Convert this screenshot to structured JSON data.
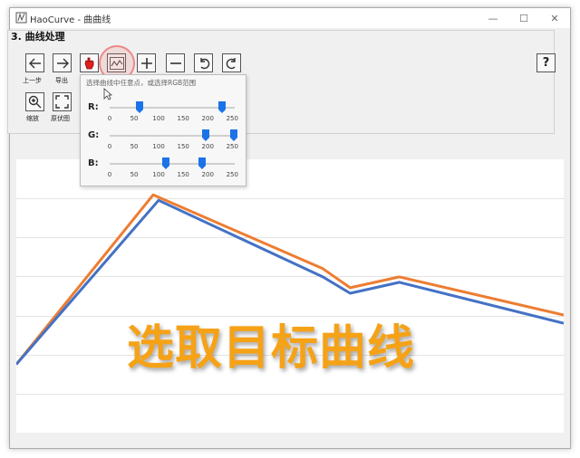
{
  "window": {
    "title": "HaoCurve - 曲曲线",
    "minimize": "—",
    "maximize": "☐",
    "close": "✕"
  },
  "group": {
    "title": "3. 曲线处理"
  },
  "toolbar": {
    "back_label": "上一步",
    "export_label": "导出",
    "zoom_label": "缩放",
    "fullscreen_label": "原伏图",
    "help_label": "?",
    "icons": [
      "arrow-left-icon",
      "arrow-right-icon",
      "hand-pointer-icon",
      "curve-select-icon",
      "plus-icon",
      "minus-icon",
      "undo-icon",
      "redo-icon",
      "zoom-in-icon",
      "fullscreen-icon"
    ]
  },
  "popup": {
    "hint": "选择曲线中任意点，或选择RGB范围",
    "channels": [
      {
        "label": "R:",
        "range": [
          61,
          230
        ]
      },
      {
        "label": "G:",
        "range": [
          195,
          253
        ]
      },
      {
        "label": "B:",
        "range": [
          115,
          188
        ]
      }
    ],
    "ticks": [
      "0",
      "50",
      "100",
      "150",
      "200",
      "250"
    ],
    "slider_max": 255,
    "thumb_color": "#1a73e8"
  },
  "overlay": {
    "text": "选取目标曲线",
    "color": "#f5a217"
  },
  "chart_data": {
    "type": "line",
    "series": [
      {
        "color": "#ed7d31",
        "x": [
          0,
          0.25,
          0.56,
          0.61,
          0.7,
          1.0
        ],
        "y": [
          0.25,
          0.87,
          0.6,
          0.53,
          0.57,
          0.43
        ]
      },
      {
        "color": "#4472c4",
        "x": [
          0,
          0.26,
          0.56,
          0.61,
          0.7,
          1.0
        ],
        "y": [
          0.25,
          0.85,
          0.57,
          0.51,
          0.55,
          0.4
        ]
      }
    ],
    "grid": true
  }
}
